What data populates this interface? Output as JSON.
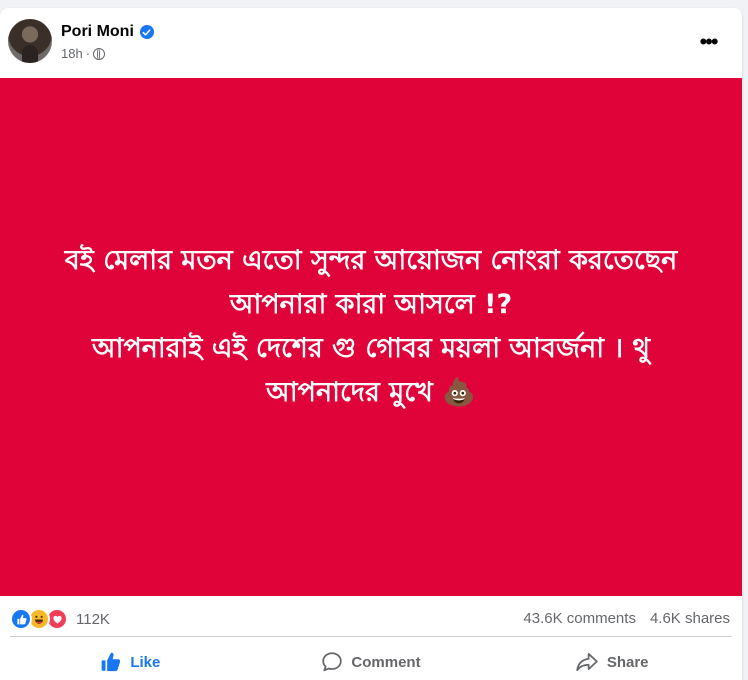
{
  "post": {
    "author": "Pori Moni",
    "time": "18h",
    "separator": "·",
    "text_lines": [
      "বই মেলার মতন এতো সুন্দর আয়োজন নোংরা করতেছেন",
      "আপনারা কারা আসলে !?",
      "আপনারাই এই দেশের গু গোবর ময়লা আবর্জনা । থু",
      "আপনাদের মুখে 💩"
    ],
    "background_color": "#e0033a"
  },
  "stats": {
    "reactions_count": "112K",
    "comments": "43.6K comments",
    "shares": "4.6K shares",
    "reaction_icons": [
      "like-reaction",
      "haha-reaction",
      "love-reaction"
    ]
  },
  "actions": {
    "like": "Like",
    "comment": "Comment",
    "share": "Share"
  },
  "colors": {
    "accent": "#1877f2",
    "muted": "#65676b"
  }
}
